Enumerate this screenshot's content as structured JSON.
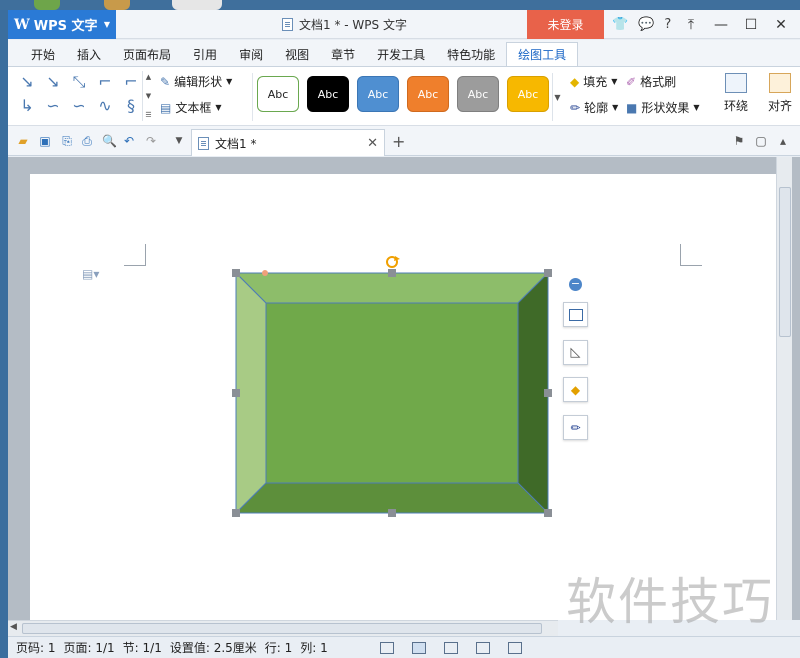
{
  "app": {
    "name": "WPS 文字",
    "window_title": "文档1 * - WPS 文字",
    "login": "未登录"
  },
  "menu_tabs": [
    "开始",
    "插入",
    "页面布局",
    "引用",
    "审阅",
    "视图",
    "章节",
    "开发工具",
    "特色功能",
    "绘图工具"
  ],
  "active_tab": "绘图工具",
  "ribbon": {
    "edit_shape": "编辑形状",
    "text_box": "文本框",
    "styles": [
      {
        "label": "Abc",
        "fill": "#ffffff",
        "border": "#6aa84f",
        "text": "#222222"
      },
      {
        "label": "Abc",
        "fill": "#000000",
        "border": "#000000",
        "text": "#ffffff"
      },
      {
        "label": "Abc",
        "fill": "#4f8fd1",
        "border": "#3b76b5",
        "text": "#ffffff"
      },
      {
        "label": "Abc",
        "fill": "#ef7f2c",
        "border": "#d06a1e",
        "text": "#ffffff"
      },
      {
        "label": "Abc",
        "fill": "#9c9c9c",
        "border": "#7f7f7f",
        "text": "#ffffff"
      },
      {
        "label": "Abc",
        "fill": "#f7b800",
        "border": "#d9a000",
        "text": "#ffffff"
      }
    ],
    "fill": "填充",
    "format_painter": "格式刷",
    "outline": "轮廓",
    "shape_effects": "形状效果",
    "wrap": "环绕",
    "align": "对齐"
  },
  "doc_tab": {
    "title": "文档1 *"
  },
  "status": {
    "page": "页码: 1",
    "pages": "页面: 1/1",
    "section": "节: 1/1",
    "setting": "设置值: 2.5厘米",
    "row": "行: 1",
    "col": "列: 1"
  },
  "watermark": "软件技巧",
  "colors": {
    "bevel_face": "#70a94a",
    "bevel_top": "#8dbd6a",
    "bevel_left": "#a8cb85",
    "bevel_right": "#3f6a28",
    "bevel_bottom": "#5d8f3b",
    "accent": "#2a7ad6",
    "login": "#e8624a"
  }
}
